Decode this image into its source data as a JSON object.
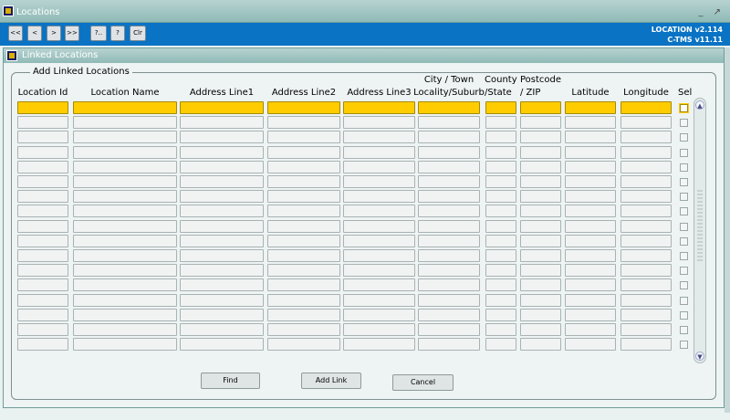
{
  "window": {
    "title": "Locations",
    "buttons": "_ ↗"
  },
  "toolbar": {
    "nav_buttons": [
      "<<",
      "<",
      ">",
      ">>"
    ],
    "help_buttons": [
      "?..",
      "?",
      "Clr"
    ],
    "version_line1": "LOCATION v2.114",
    "version_line2": "C-TMS v11.11"
  },
  "subwindow": {
    "title": "Linked Locations"
  },
  "group": {
    "legend": "Add Linked Locations"
  },
  "columns": [
    {
      "key": "location_id",
      "line1": "",
      "line2": "Location Id"
    },
    {
      "key": "location_name",
      "line1": "",
      "line2": "Location Name"
    },
    {
      "key": "address1",
      "line1": "",
      "line2": "Address Line1"
    },
    {
      "key": "address2",
      "line1": "",
      "line2": "Address Line2"
    },
    {
      "key": "address3",
      "line1": "",
      "line2": "Address Line3"
    },
    {
      "key": "city",
      "line1": "City / Town",
      "line2": "Locality/Suburb"
    },
    {
      "key": "county",
      "line1": "County",
      "line2": "/State"
    },
    {
      "key": "postcode",
      "line1": "Postcode",
      "line2": "/ ZIP"
    },
    {
      "key": "latitude",
      "line1": "",
      "line2": "Latitude"
    },
    {
      "key": "longitude",
      "line1": "",
      "line2": "Longitude"
    },
    {
      "key": "sel",
      "line1": "",
      "line2": "Sel"
    }
  ],
  "grid": {
    "row_count": 17,
    "selected_row": 0
  },
  "buttons": {
    "find": "Find",
    "add_link": "Add Link",
    "cancel": "Cancel"
  },
  "colors": {
    "toolbar": "#0a73c4",
    "current_row": "#ffcc00"
  }
}
